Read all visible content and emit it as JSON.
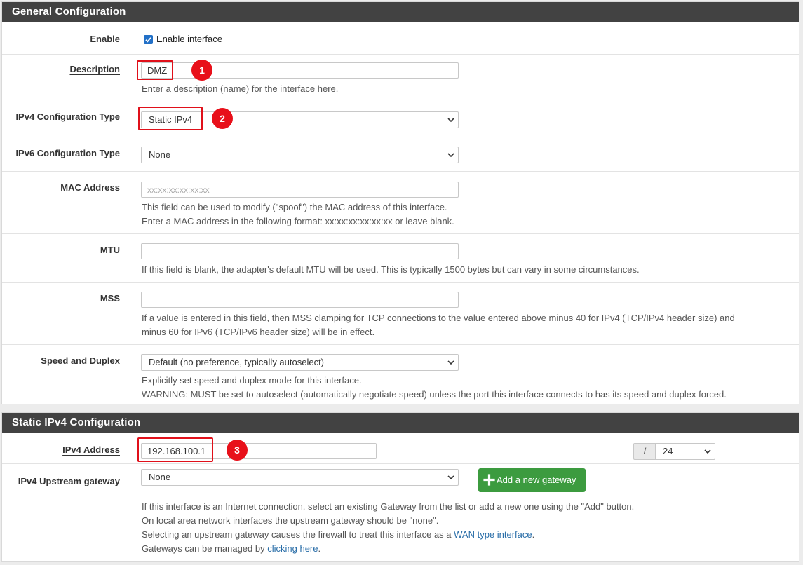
{
  "general": {
    "heading": "General Configuration",
    "enable": {
      "label": "Enable",
      "checkbox_label": "Enable interface",
      "checked": true
    },
    "description": {
      "label": "Description",
      "value": "DMZ",
      "help": "Enter a description (name) for the interface here."
    },
    "ipv4_type": {
      "label": "IPv4 Configuration Type",
      "value": "Static IPv4"
    },
    "ipv6_type": {
      "label": "IPv6 Configuration Type",
      "value": "None"
    },
    "mac": {
      "label": "MAC Address",
      "placeholder": "xx:xx:xx:xx:xx:xx",
      "help1": "This field can be used to modify (\"spoof\") the MAC address of this interface.",
      "help2": "Enter a MAC address in the following format: xx:xx:xx:xx:xx:xx or leave blank."
    },
    "mtu": {
      "label": "MTU",
      "value": "",
      "help": "If this field is blank, the adapter's default MTU will be used. This is typically 1500 bytes but can vary in some circumstances."
    },
    "mss": {
      "label": "MSS",
      "value": "",
      "help1": "If a value is entered in this field, then MSS clamping for TCP connections to the value entered above minus 40 for IPv4 (TCP/IPv4 header size) and",
      "help2": "minus 60 for IPv6 (TCP/IPv6 header size) will be in effect."
    },
    "speed": {
      "label": "Speed and Duplex",
      "value": "Default (no preference, typically autoselect)",
      "help1": "Explicitly set speed and duplex mode for this interface.",
      "help2": "WARNING: MUST be set to autoselect (automatically negotiate speed) unless the port this interface connects to has its speed and duplex forced."
    }
  },
  "static_ipv4": {
    "heading": "Static IPv4 Configuration",
    "address": {
      "label": "IPv4 Address",
      "value": "192.168.100.1",
      "slash": "/",
      "cidr": "24"
    },
    "gateway": {
      "label": "IPv4 Upstream gateway",
      "value": "None",
      "add_button": "Add a new gateway",
      "help1": "If this interface is an Internet connection, select an existing Gateway from the list or add a new one using the \"Add\" button.",
      "help2": "On local area network interfaces the upstream gateway should be \"none\".",
      "help3_pre": "Selecting an upstream gateway causes the firewall to treat this interface as a ",
      "help3_link": "WAN type interface",
      "help3_post": ".",
      "help4_pre": "Gateways can be managed by ",
      "help4_link": "clicking here",
      "help4_post": "."
    }
  },
  "annotations": {
    "one": "1",
    "two": "2",
    "three": "3"
  },
  "colors": {
    "heading_bg": "#424242",
    "highlight": "#e0101a",
    "button_green": "#3c9b3f",
    "link": "#2a6ea8"
  }
}
